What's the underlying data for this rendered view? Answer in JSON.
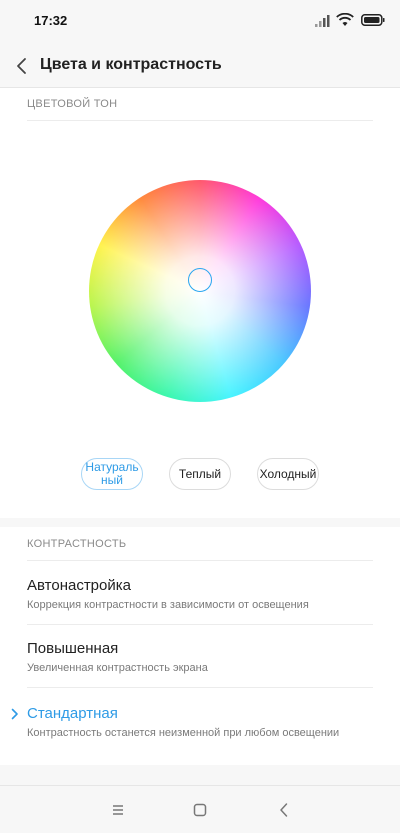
{
  "status_bar": {
    "time": "17:32"
  },
  "header": {
    "title": "Цвета и контрастность"
  },
  "color_tone": {
    "section_label": "ЦВЕТОВОЙ ТОН",
    "modes": [
      {
        "label": "Натураль\nный",
        "selected": true
      },
      {
        "label": "Теплый",
        "selected": false
      },
      {
        "label": "Холодный",
        "selected": false
      }
    ],
    "accent_color": "#2e9be6"
  },
  "contrast": {
    "section_label": "КОНТРАСТНОСТЬ",
    "options": [
      {
        "title": "Автонастройка",
        "subtitle": "Коррекция контрастности в зависимости от освещения",
        "selected": false
      },
      {
        "title": "Повышенная",
        "subtitle": "Увеличенная контрастность экрана",
        "selected": false
      },
      {
        "title": "Стандартная",
        "subtitle": "Контрастность останется неизменной при любом освещении",
        "selected": true
      }
    ]
  },
  "icons": {
    "back": "chevron-left-icon",
    "signal": "signal-icon",
    "wifi": "wifi-icon",
    "battery": "battery-icon",
    "check": "chevron-right-icon",
    "nav_menu": "menu-icon",
    "nav_home": "home-icon",
    "nav_back": "back-icon"
  }
}
